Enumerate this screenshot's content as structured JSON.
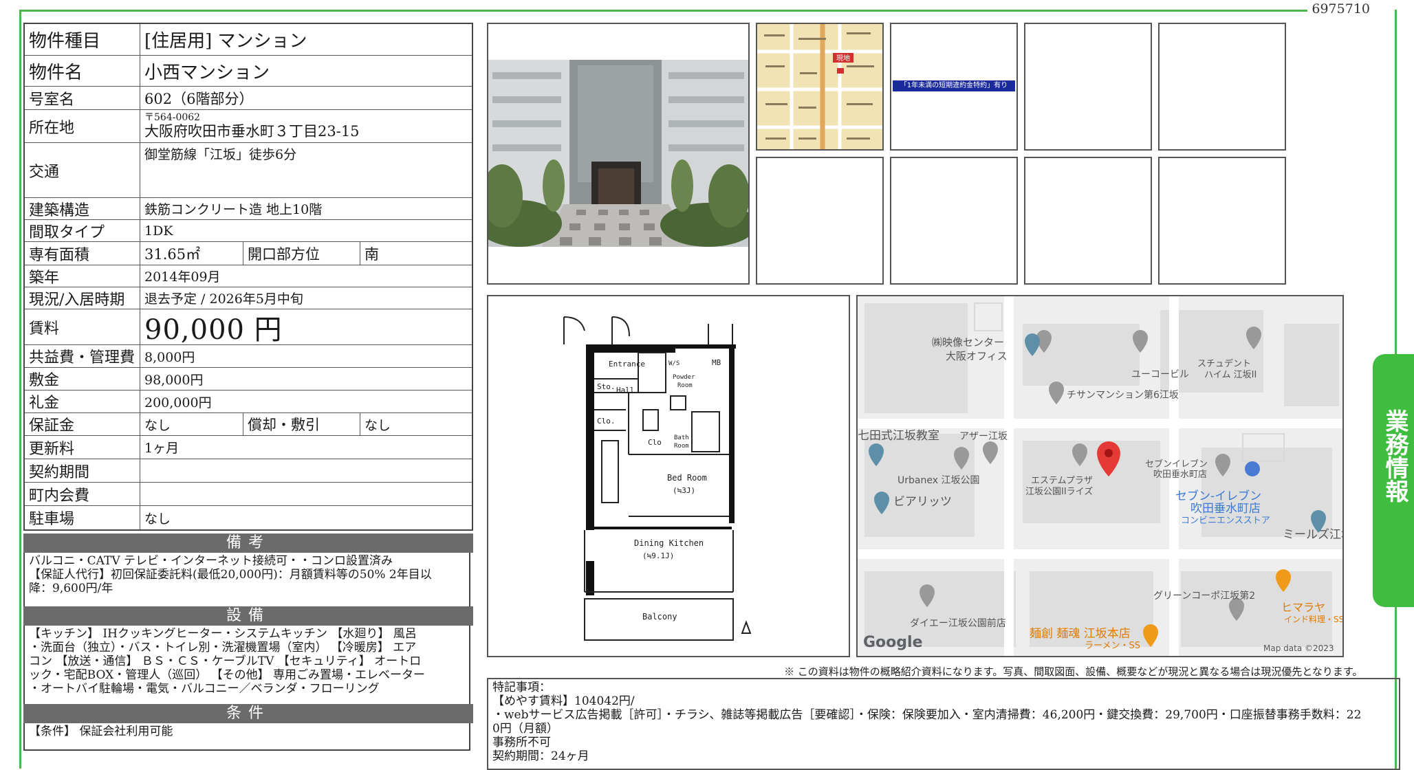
{
  "doc_id": "6975710",
  "side_tab": "業務情報",
  "spec": {
    "type_label": "物件種目",
    "type_value": "[住居用] マンション",
    "name_label": "物件名",
    "name_value": "小西マンション",
    "room_label": "号室名",
    "room_value": "602（6階部分）",
    "addr_label": "所在地",
    "zip": "〒564-0062",
    "addr_value": "大阪府吹田市垂水町３丁目23-15",
    "traffic_label": "交通",
    "traffic_value": "御堂筋線「江坂」徒歩6分",
    "struct_label": "建築構造",
    "struct_value": "鉄筋コンクリート造 地上10階",
    "layout_label": "間取タイプ",
    "layout_value": "1DK",
    "area_label": "専有面積",
    "area_value": "31.65㎡",
    "dir_label": "開口部方位",
    "dir_value": "南",
    "built_label": "築年",
    "built_value": "2014年09月",
    "status_label": "現況/入居時期",
    "status_value": "退去予定 / 2026年5月中旬",
    "rent_label": "賃料",
    "rent_value": "90,000 円",
    "fee_label": "共益費・管理費",
    "fee_value": "8,000円",
    "deposit_label": "敷金",
    "deposit_value": "98,000円",
    "keymoney_label": "礼金",
    "keymoney_value": "200,000円",
    "guarantee_label": "保証金",
    "guarantee_value": "なし",
    "amort_label": "償却・敷引",
    "amort_value": "なし",
    "renew_label": "更新料",
    "renew_value": "1ヶ月",
    "contract_label": "契約期間",
    "contract_value": "",
    "assoc_label": "町内会費",
    "assoc_value": "",
    "parking_label": "駐車場",
    "parking_value": "なし"
  },
  "sections": {
    "remarks_h": "備考",
    "remarks_1": "バルコニ・CATV テレビ・インターネット接続可・・コンロ設置済み",
    "remarks_2": "【保証人代行】初回保証委託料(最低20,000円)：月額賃料等の50% 2年目以",
    "remarks_3": "降：9,600円/年",
    "equip_h": "設備",
    "equip_1": "【キッチン】 IHクッキングヒーター・システムキッチン 【水廻り】 風呂",
    "equip_2": "・洗面台（独立）・バス・トイレ別・洗濯機置場（室内） 【冷暖房】 エア",
    "equip_3": "コン 【放送・通信】 ＢＳ・ＣＳ・ケーブルTV 【セキュリティ】 オートロ",
    "equip_4": "ック・宅配BOX・管理人（巡回） 【その他】 専用ごみ置場・エレベーター",
    "equip_5": "・オートバイ駐輪場・電気・バルコニー／ベランダ・フローリング",
    "cond_h": "条件",
    "cond_1": "【条件】 保証会社利用可能"
  },
  "thumb_notice": "「1年未満の短期違約金特約」有り",
  "small_map": {
    "here": "現地"
  },
  "floorplan": {
    "entrance": "Entrance",
    "ws": "W/S",
    "mb": "MB",
    "sto": "Sto.",
    "hall": "Hall",
    "powder": "Powder",
    "room": "Room",
    "clo": "Clo.",
    "clo2": "Clo",
    "bath": "Bath",
    "bathroom": "Room",
    "bedroom": "Bed Room",
    "bedsize": "(≒3J)",
    "dining": "Dining Kitchen",
    "dksize": "(≒9.1J)",
    "balcony": "Balcony"
  },
  "map": {
    "labels": [
      "㈱映像センター",
      "大阪オフィス",
      "スチュデント",
      "ハイム 江坂II",
      "ユーコービル",
      "チサンマンション第6江坂",
      "七田式江坂教室",
      "アザー江坂",
      "Urbanex 江坂公園",
      "エステムプラザ",
      "江坂公園IIライズ",
      "セブンイレブン",
      "吹田垂水町店",
      "セブン-イレブン",
      "吹田垂水町店",
      "コンビニエンスストア",
      "ビアリッツ",
      "ミールズ江坂",
      "グリーンコーポ江坂第2",
      "ヒマラヤ",
      "インド料理・SS",
      "ダイエー江坂公園前店",
      "麺創 麺魂 江坂本店",
      "ラーメン・SS"
    ],
    "google": "Google",
    "attribution": "Map data ©2023"
  },
  "disclaimer": "※ この資料は物件の概略紹介資料になります。写真、間取図面、設備、概要などが現況と異なる場合は現況優先となります。",
  "special": {
    "l1": "特記事項：",
    "l2": "【めやす賃料】104042円/",
    "l3": "・webサービス広告掲載［許可］・チラシ、雑誌等掲載広告［要確認］・保険：保険要加入・室内清掃費：46,200円・鍵交換費：29,700円・口座振替事務手数料：22",
    "l4": "0円（月額）",
    "l5": "事務所不可",
    "l6": "契約期間：24ヶ月"
  },
  "colors": {
    "frame": "#4cb84c",
    "tab": "#3fbd3f",
    "section": "#6b6b6b",
    "notice": "#1a2a9c",
    "pin": "#e53935"
  }
}
